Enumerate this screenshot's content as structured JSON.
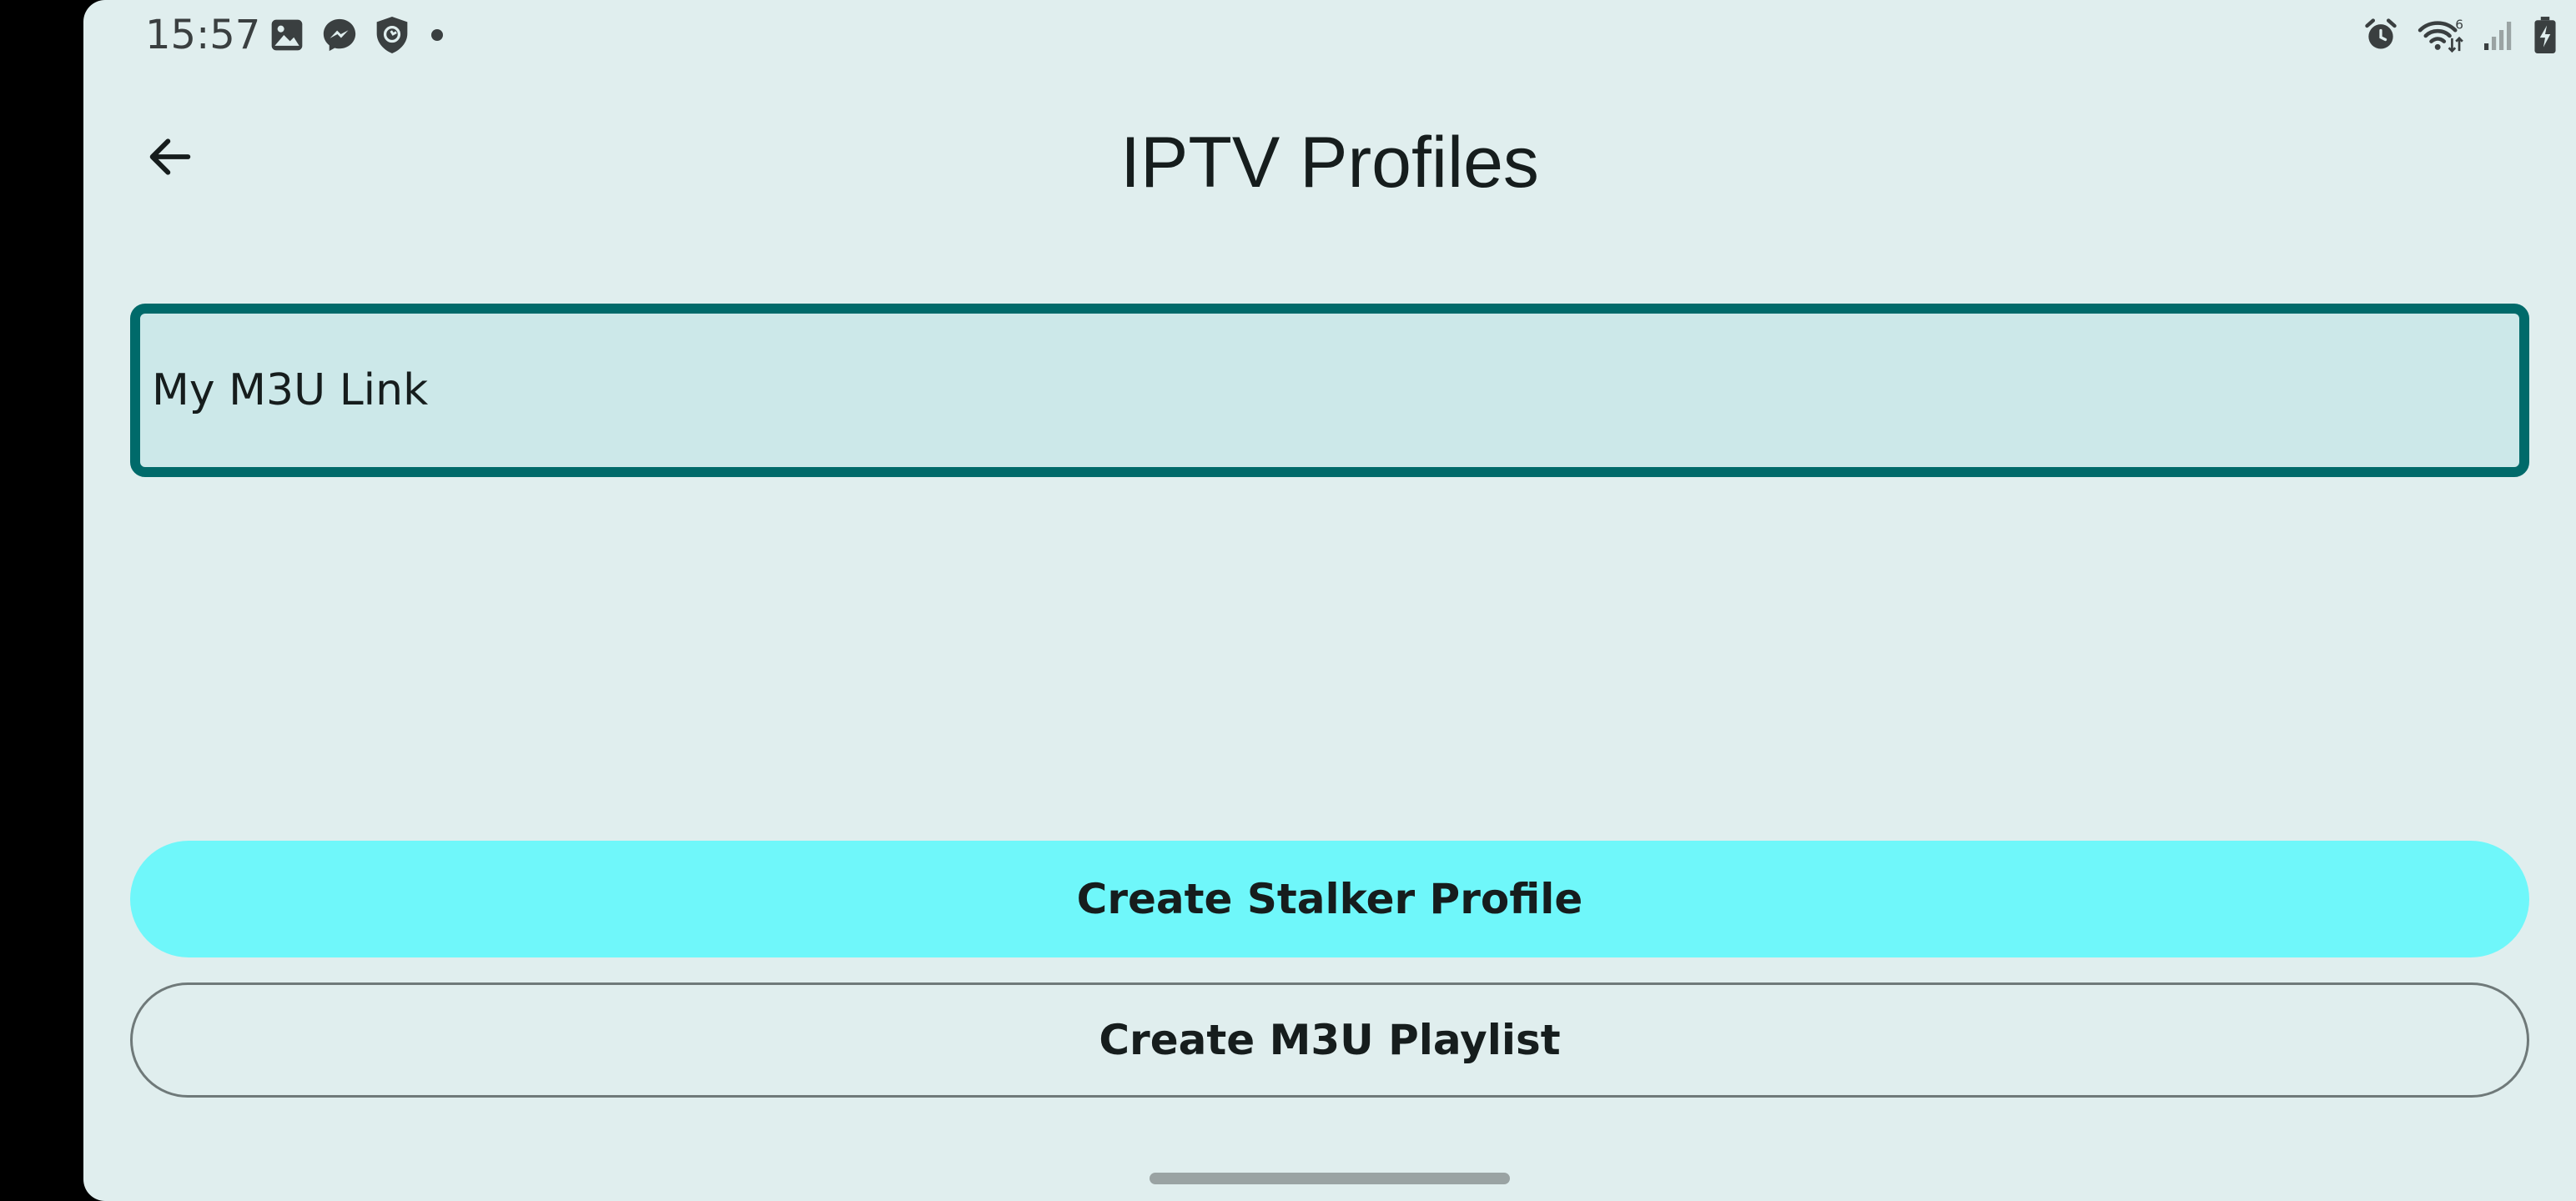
{
  "status_bar": {
    "time": "15:57",
    "left_icons": [
      "gallery-icon",
      "messenger-icon",
      "shield-icon",
      "notification-dot-icon"
    ],
    "right_icons": [
      "alarm-icon",
      "wifi-6-icon",
      "cellular-signal-icon",
      "battery-charging-icon"
    ]
  },
  "app_bar": {
    "back_icon": "arrow-left-icon",
    "title": "IPTV Profiles"
  },
  "profile_name_field": {
    "value": "My M3U Link"
  },
  "actions": {
    "create_stalker_label": "Create Stalker Profile",
    "create_m3u_label": "Create M3U Playlist"
  },
  "colors": {
    "background": "#e0eeee",
    "field_border": "#006a6a",
    "field_fill": "#cce8e9",
    "primary_button": "#6ff7fa",
    "outline_border": "#6f7979",
    "text": "#161d1d"
  }
}
